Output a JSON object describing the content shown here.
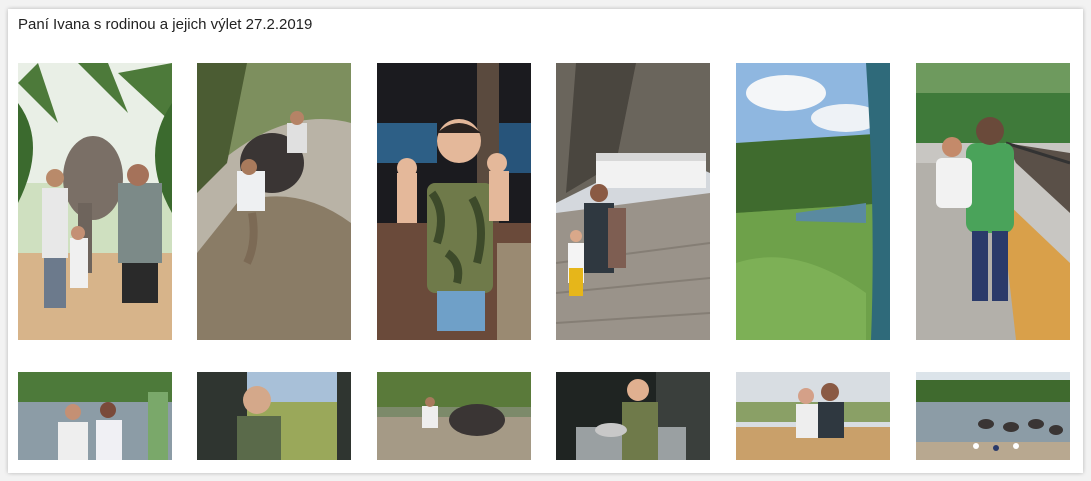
{
  "gallery": {
    "title": "Paní Ivana s rodinou a jejich výlet 27.2.2019"
  },
  "photos": [
    {
      "name": "photo-elephant-family",
      "subject": "family with elephant under palm trees"
    },
    {
      "name": "photo-elephant-bath-river",
      "subject": "man bathing elephant in river"
    },
    {
      "name": "photo-boy-night",
      "subject": "boy in camouflage shirt at night"
    },
    {
      "name": "photo-rock-temple",
      "subject": "family at rock temple"
    },
    {
      "name": "photo-train-jungle",
      "subject": "train through green jungle"
    },
    {
      "name": "photo-train-station",
      "subject": "man holding child at train station"
    },
    {
      "name": "photo-river-group",
      "subject": "group by river with elephants"
    },
    {
      "name": "photo-boy-field",
      "subject": "boy in field"
    },
    {
      "name": "photo-elephant-water",
      "subject": "elephant in water"
    },
    {
      "name": "photo-boy-dark",
      "subject": "boy with animal in dark room"
    },
    {
      "name": "photo-family-wall",
      "subject": "family on stone wall"
    },
    {
      "name": "photo-elephant-herd",
      "subject": "elephant herd at river"
    }
  ]
}
